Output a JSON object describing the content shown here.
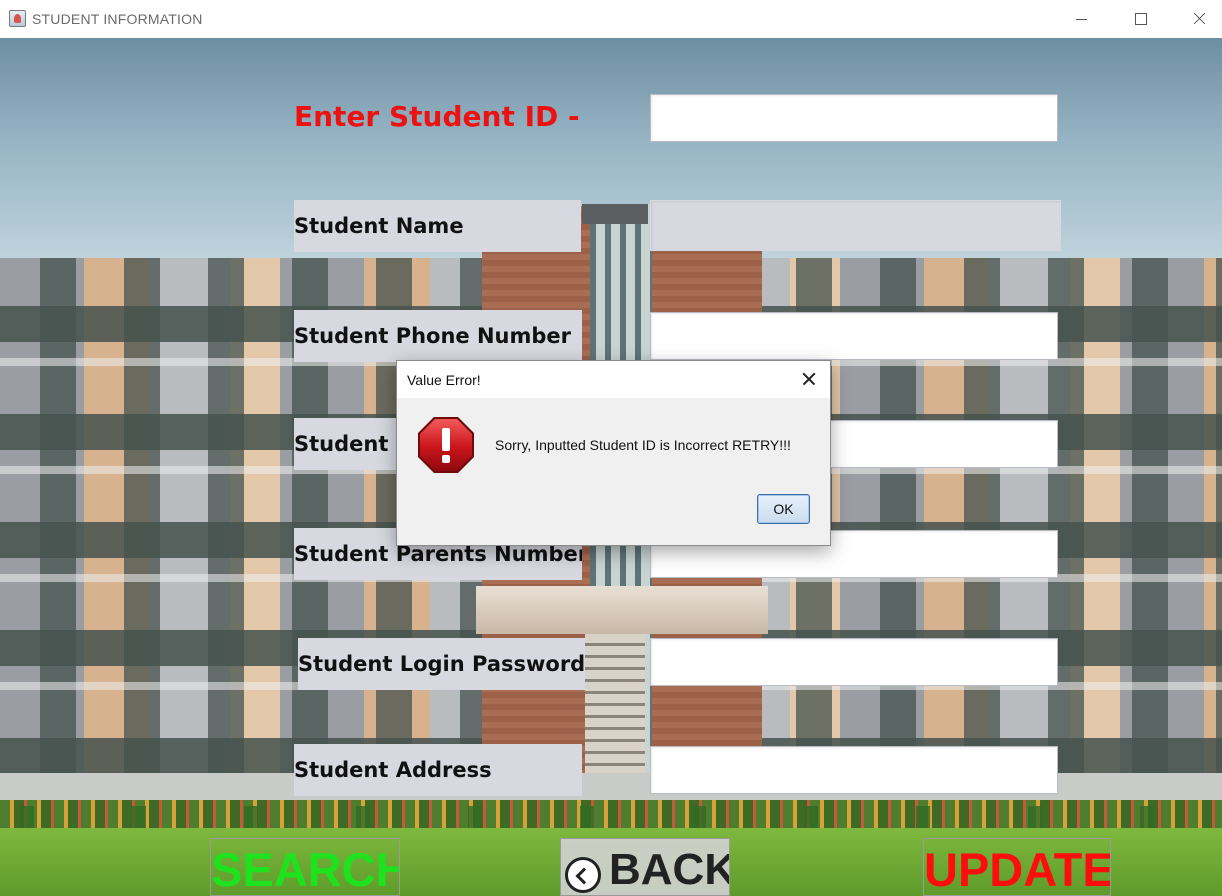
{
  "window": {
    "title": "STUDENT INFORMATION",
    "icon": "java-cup-icon"
  },
  "form": {
    "prompt": "Enter Student ID  -",
    "student_id_value": "",
    "fields": [
      {
        "label": "Student Name",
        "value": ""
      },
      {
        "label": "Student Phone Number",
        "value": ""
      },
      {
        "label": "Student Email",
        "value": ""
      },
      {
        "label": "Student Parents Number",
        "value": ""
      },
      {
        "label": "Student Login Password",
        "value": ""
      },
      {
        "label": "Student Address",
        "value": ""
      }
    ]
  },
  "buttons": {
    "search": "SEARCH",
    "back": "BACK",
    "update": "UPDATE"
  },
  "dialog": {
    "title": "Value Error!",
    "message": "Sorry, Inputted  Student ID is Incorrect RETRY!!!",
    "ok": "OK",
    "icon": "error-stop-icon"
  },
  "colors": {
    "prompt": "#ee1111",
    "search": "#1ee21e",
    "update": "#ff0d0d",
    "label_bg": "#d7d8e0"
  }
}
